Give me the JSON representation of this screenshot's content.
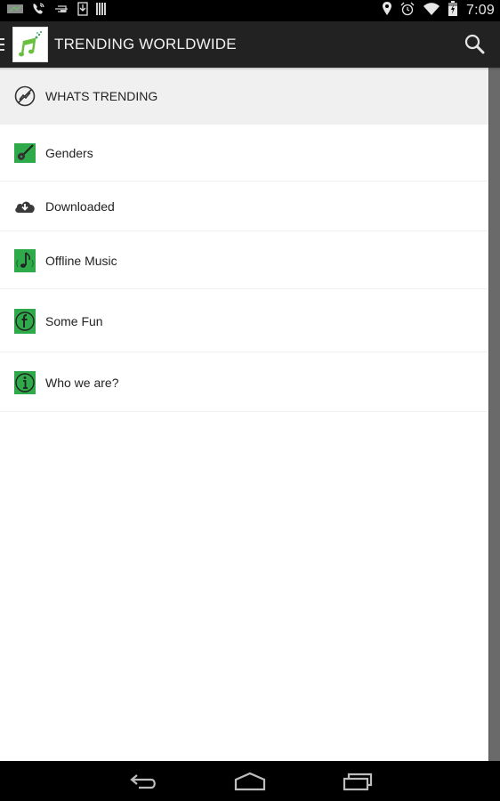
{
  "status_bar": {
    "left_icons": [
      "image-notification-icon",
      "phone-call-icon",
      "usb-debug-icon",
      "download-icon",
      "barcode-icon"
    ],
    "right_icons": [
      "location-icon",
      "alarm-icon",
      "wifi-icon",
      "battery-charging-icon"
    ],
    "time": "7:09"
  },
  "action_bar": {
    "title": "TRENDING WORLDWIDE",
    "logo_icon": "music-notes-icon",
    "search_icon": "search-icon"
  },
  "drawer": {
    "items": [
      {
        "label": "WHATS TRENDING",
        "icon": "trending-off-icon",
        "active": true
      },
      {
        "label": "Genders",
        "icon": "guitar-icon",
        "active": false
      },
      {
        "label": "Downloaded",
        "icon": "cloud-download-icon",
        "active": false
      },
      {
        "label": "Offline Music",
        "icon": "music-note-icon",
        "active": false
      },
      {
        "label": "Some Fun",
        "icon": "facebook-icon",
        "active": false
      },
      {
        "label": "Who we are?",
        "icon": "info-icon",
        "active": false
      }
    ]
  },
  "nav_bar": {
    "buttons": [
      "back-icon",
      "home-icon",
      "recent-apps-icon"
    ]
  },
  "colors": {
    "action_bar": "#222222",
    "accent_green": "#2eaa4a",
    "active_item_bg": "#f0f0f0",
    "scrim": "#6a6a6a"
  }
}
